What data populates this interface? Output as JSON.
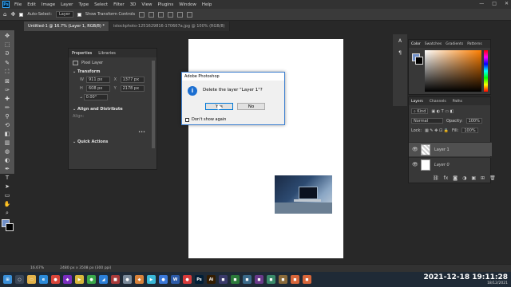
{
  "app": {
    "logo": "Ps",
    "menu": [
      "File",
      "Edit",
      "Image",
      "Layer",
      "Type",
      "Select",
      "Filter",
      "3D",
      "View",
      "Plugins",
      "Window",
      "Help"
    ],
    "window_controls": [
      "—",
      "□",
      "✕"
    ]
  },
  "options_bar": {
    "auto_select_label": "Auto-Select:",
    "auto_select_value": "Layer",
    "show_transform_label": "Show Transform Controls"
  },
  "tabs": [
    {
      "label": "Untitled-1 @ 16.7% (Layer 1, RGB/8) *",
      "active": true
    },
    {
      "label": "istockphoto-1251629816-170667a.jpg @ 100% (RGB/8)",
      "active": false
    }
  ],
  "tools": [
    "move-icon",
    "marquee-icon",
    "lasso-icon",
    "quick-select-icon",
    "crop-icon",
    "frame-icon",
    "eyedropper-icon",
    "healing-icon",
    "brush-icon",
    "stamp-icon",
    "history-brush-icon",
    "eraser-icon",
    "gradient-icon",
    "blur-icon",
    "dodge-icon",
    "pen-icon",
    "type-icon",
    "path-select-icon",
    "shape-icon",
    "hand-icon",
    "zoom-icon"
  ],
  "tool_glyphs": [
    "✥",
    "⬚",
    "ᘐ",
    "✎",
    "⛶",
    "⊠",
    "✑",
    "✚",
    "✏",
    "⚲",
    "⟲",
    "◧",
    "▥",
    "◍",
    "◐",
    "✒",
    "T",
    "➤",
    "▭",
    "✋",
    "⌕"
  ],
  "properties": {
    "tabs": [
      "Properties",
      "Libraries"
    ],
    "pixel_layer": "Pixel Layer",
    "transform_title": "Transform",
    "w_label": "W",
    "w_value": "911 px",
    "x_label": "X",
    "x_value": "1377 px",
    "h_label": "H",
    "h_value": "608 px",
    "y_label": "Y",
    "y_value": "2178 px",
    "angle_value": "0.00°",
    "align_title": "Align and Distribute",
    "align_label": "Align:",
    "quick_actions_title": "Quick Actions"
  },
  "dialog": {
    "title": "Adobe Photoshop",
    "message": "Delete the layer \"Layer 1\"?",
    "yes_label": "Yes",
    "no_label": "No",
    "checkbox_label": "Don't show again"
  },
  "color_panel": {
    "tabs": [
      "Color",
      "Swatches",
      "Gradients",
      "Patterns"
    ],
    "fg_color": "#7190c8",
    "bg_color": "#000000"
  },
  "layers_panel": {
    "tabs": [
      "Layers",
      "Channels",
      "Paths"
    ],
    "kind_label": "Kind",
    "blend_mode": "Normal",
    "opacity_label": "Opacity:",
    "opacity_value": "100%",
    "lock_label": "Lock:",
    "fill_label": "Fill:",
    "fill_value": "100%",
    "layers": [
      {
        "name": "Layer 1",
        "selected": true
      },
      {
        "name": "Layer 0",
        "selected": false
      }
    ],
    "footer_icons": [
      "link-icon",
      "fx-icon",
      "mask-icon",
      "adjustment-icon",
      "group-icon",
      "new-layer-icon",
      "trash-icon"
    ],
    "footer_glyphs": [
      "⛓",
      "fx",
      "◙",
      "◑",
      "▣",
      "⊞",
      "🗑"
    ]
  },
  "status_bar": {
    "zoom": "16.67%",
    "doc_size": "2480 px x 3508 px (300 ppi)"
  },
  "taskbar": {
    "icons": [
      {
        "name": "windows-icon",
        "glyph": "⊞",
        "color": "#3a8fd8"
      },
      {
        "name": "search-icon",
        "glyph": "○",
        "color": "#3a4656"
      },
      {
        "name": "file-explorer-icon",
        "glyph": "▭",
        "color": "#e3b34a"
      },
      {
        "name": "edge-icon",
        "glyph": "e",
        "color": "#2b8ad8"
      },
      {
        "name": "chrome-icon",
        "glyph": "●",
        "color": "#d8453a"
      },
      {
        "name": "app-icon-1",
        "glyph": "◆",
        "color": "#7a2dbf"
      },
      {
        "name": "app-icon-2",
        "glyph": "▶",
        "color": "#d8b83a"
      },
      {
        "name": "app-icon-3",
        "glyph": "●",
        "color": "#3aa84a"
      },
      {
        "name": "vscode-icon",
        "glyph": "◢",
        "color": "#2b7fd8"
      },
      {
        "name": "app-icon-4",
        "glyph": "■",
        "color": "#a83a3a"
      },
      {
        "name": "app-icon-5",
        "glyph": "●",
        "color": "#7a8a9a"
      },
      {
        "name": "app-icon-6",
        "glyph": "◆",
        "color": "#d8823a"
      },
      {
        "name": "app-icon-7",
        "glyph": "▶",
        "color": "#3ab8d8"
      },
      {
        "name": "app-icon-8",
        "glyph": "●",
        "color": "#3a78d8"
      },
      {
        "name": "app-icon-9",
        "glyph": "W",
        "color": "#2b5aa8"
      },
      {
        "name": "app-icon-10",
        "glyph": "●",
        "color": "#d83a3a"
      },
      {
        "name": "photoshop-icon",
        "glyph": "Ps",
        "color": "#001e36"
      },
      {
        "name": "illustrator-icon",
        "glyph": "Ai",
        "color": "#331c00"
      },
      {
        "name": "app-icon-11",
        "glyph": "◼",
        "color": "#3a3a6a"
      },
      {
        "name": "app-icon-12",
        "glyph": "◼",
        "color": "#2b7a3a"
      },
      {
        "name": "app-icon-13",
        "glyph": "◼",
        "color": "#3a6a8a"
      },
      {
        "name": "app-icon-14",
        "glyph": "◼",
        "color": "#6a3a8a"
      },
      {
        "name": "app-icon-15",
        "glyph": "◼",
        "color": "#3a8a6a"
      },
      {
        "name": "app-icon-16",
        "glyph": "◼",
        "color": "#8a6a3a"
      },
      {
        "name": "app-icon-17",
        "glyph": "◼",
        "color": "#d8663a"
      },
      {
        "name": "app-icon-18",
        "glyph": "◼",
        "color": "#d8663a"
      }
    ]
  },
  "clock": {
    "overlay": "2021-12-18  19:11:28",
    "date": "18/12/2021"
  }
}
